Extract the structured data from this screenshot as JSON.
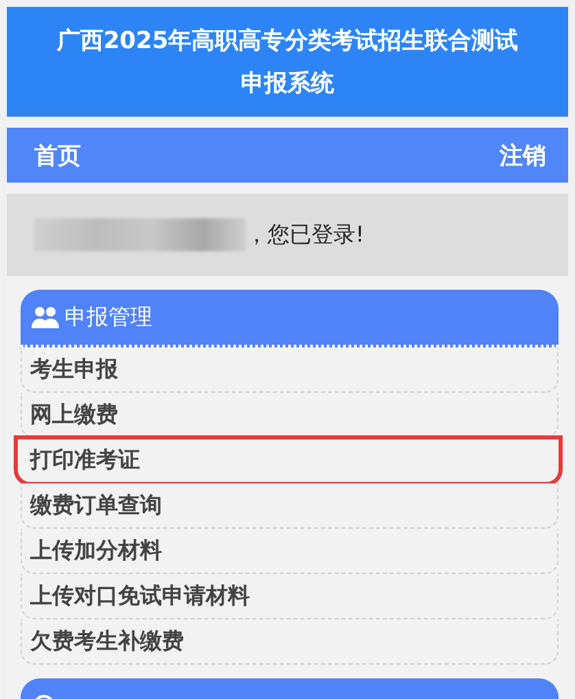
{
  "header": {
    "title_line_1": "广西2025年高职高专分类考试招生联合测试",
    "title_line_2": "申报系统"
  },
  "nav": {
    "home": "首页",
    "logout": "注销"
  },
  "login_notice": {
    "name_redacted": true,
    "message": "，您已登录!"
  },
  "sections": [
    {
      "kind": "menu",
      "title": "申报管理",
      "items": [
        {
          "label": "考生申报",
          "highlighted": false
        },
        {
          "label": "网上缴费",
          "highlighted": false
        },
        {
          "label": "打印准考证",
          "highlighted": true
        },
        {
          "label": "缴费订单查询",
          "highlighted": false
        },
        {
          "label": "上传加分材料",
          "highlighted": false
        },
        {
          "label": "上传对口免试申请材料",
          "highlighted": false
        },
        {
          "label": "欠费考生补缴费",
          "highlighted": false
        }
      ]
    },
    {
      "kind": "cutoff"
    }
  ]
}
